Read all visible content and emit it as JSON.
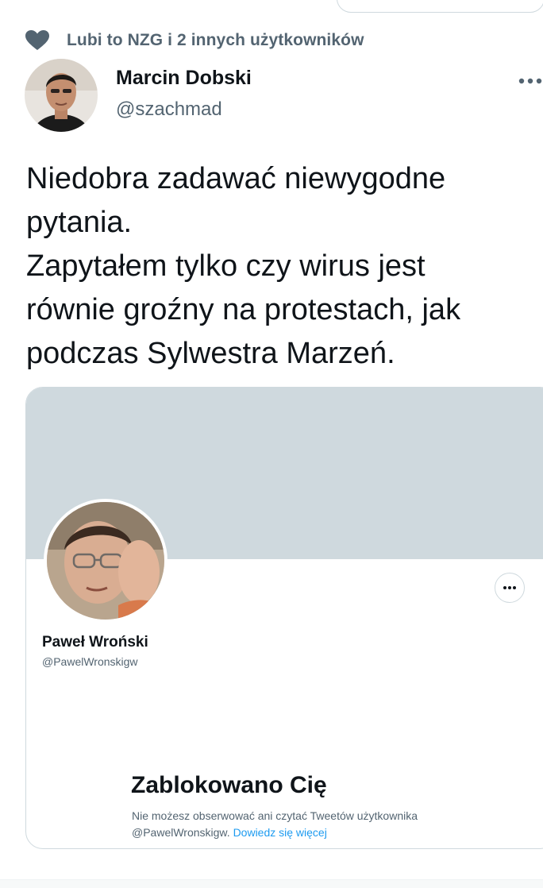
{
  "social_context": {
    "icon": "heart-icon",
    "text": "Lubi to NZG i 2 innych użytkowników"
  },
  "author": {
    "display_name": "Marcin Dobski",
    "handle": "@szachmad"
  },
  "tweet": {
    "text": "Niedobra zadawać niewygodne\npytania.\nZapytałem tylko czy wirus jest\nrównie groźny na protestach, jak\npodczas Sylwestra Marzeń."
  },
  "embedded_profile": {
    "display_name": "Paweł Wroński",
    "handle": "@PawelWronskigw",
    "blocked_title": "Zablokowano Cię",
    "blocked_text": "Nie możesz obserwować ani czytać Tweetów użytkownika @PawelWronskigw.",
    "learn_more": "Dowiedz się więcej"
  },
  "colors": {
    "text_primary": "#0f1419",
    "text_secondary": "#536471",
    "link": "#1d9bf0",
    "banner": "#cfd9de",
    "border": "#cfd9de"
  }
}
